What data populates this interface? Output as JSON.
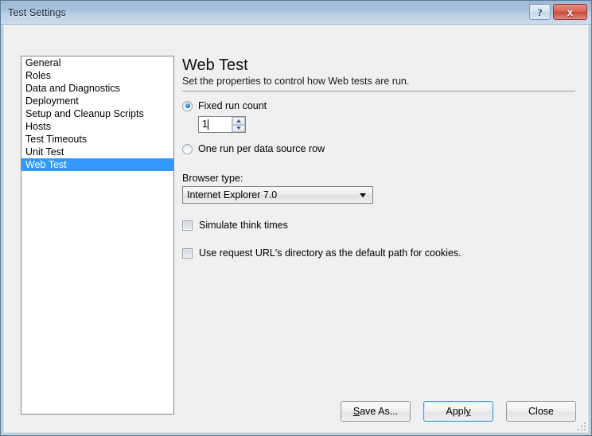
{
  "window": {
    "title": "Test Settings",
    "help_button": "?",
    "close_button": "x"
  },
  "sidebar": {
    "items": [
      {
        "label": "General",
        "selected": false
      },
      {
        "label": "Roles",
        "selected": false
      },
      {
        "label": "Data and Diagnostics",
        "selected": false
      },
      {
        "label": "Deployment",
        "selected": false
      },
      {
        "label": "Setup and Cleanup Scripts",
        "selected": false
      },
      {
        "label": "Hosts",
        "selected": false
      },
      {
        "label": "Test Timeouts",
        "selected": false
      },
      {
        "label": "Unit Test",
        "selected": false
      },
      {
        "label": "Web Test",
        "selected": true
      }
    ],
    "selected_index": 8,
    "selection_color": "#3399ff"
  },
  "pane": {
    "title": "Web Test",
    "subtitle": "Set the properties to control how Web tests are run.",
    "run_mode": {
      "fixed_run_count": {
        "label": "Fixed run count",
        "checked": true,
        "value": "1"
      },
      "one_run_per_row": {
        "label": "One run per data source row",
        "checked": false
      }
    },
    "browser_type": {
      "label": "Browser type:",
      "value": "Internet Explorer 7.0",
      "options": [
        "Internet Explorer 7.0"
      ]
    },
    "checkboxes": [
      {
        "label": "Simulate think times",
        "checked": false
      },
      {
        "label": "Use request URL's directory as the default path for cookies.",
        "checked": false
      }
    ]
  },
  "footer": {
    "save_as": {
      "pre": "",
      "accel": "S",
      "post": "ave As..."
    },
    "apply": {
      "pre": "Appl",
      "accel": "y",
      "post": ""
    },
    "close": {
      "pre": "Close",
      "accel": "",
      "post": ""
    },
    "default_button": "Apply",
    "focus_color": "#3c99dc"
  }
}
